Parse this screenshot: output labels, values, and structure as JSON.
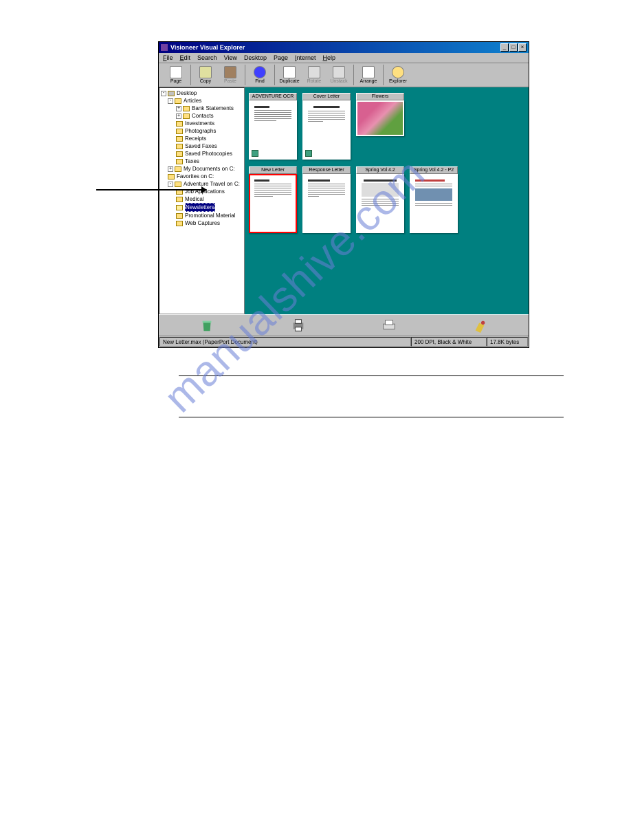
{
  "window": {
    "title": "Visioneer Visual Explorer",
    "controls": {
      "min": "_",
      "max": "□",
      "close": "×"
    }
  },
  "menu": {
    "file": "File",
    "edit": "Edit",
    "search": "Search",
    "view": "View",
    "desktop": "Desktop",
    "page": "Page",
    "internet": "Internet",
    "help": "Help"
  },
  "toolbar": {
    "page": "Page",
    "copy": "Copy",
    "paste": "Paste",
    "find": "Find",
    "duplicate": "Duplicate",
    "rotate": "Rotate",
    "unstack": "Unstack",
    "arrange": "Arrange",
    "explorer": "Explorer"
  },
  "tree": {
    "desktop": "Desktop",
    "articles": "Articles",
    "bank_statements": "Bank Statements",
    "contacts": "Contacts",
    "investments": "Investments",
    "photographs": "Photographs",
    "receipts": "Receipts",
    "saved_faxes": "Saved Faxes",
    "saved_photocopies": "Saved Photocopies",
    "taxes": "Taxes",
    "my_documents": "My Documents on C:",
    "favorites": "Favorites on C:",
    "adventure_travel": "Adventure Travel on C:",
    "job_applications": "Job Applications",
    "medical": "Medical",
    "newsletters": "Newsletters",
    "promotional": "Promotional Material",
    "web_captures": "Web Captures"
  },
  "thumbnails": {
    "row1": {
      "a": "ADVENTURE OCR",
      "b": "Cover Letter",
      "c": "Flowers"
    },
    "row2": {
      "a": "New Letter",
      "b": "Response Letter",
      "c": "Spring Vol 4.2",
      "d": "Spring Vol 4.2 - P2"
    }
  },
  "statusbar": {
    "file": "New Letter.max (PaperPort Document)",
    "dpi": "200 DPI, Black & White",
    "size": "17.8K bytes"
  },
  "watermark": "manualshive.com"
}
